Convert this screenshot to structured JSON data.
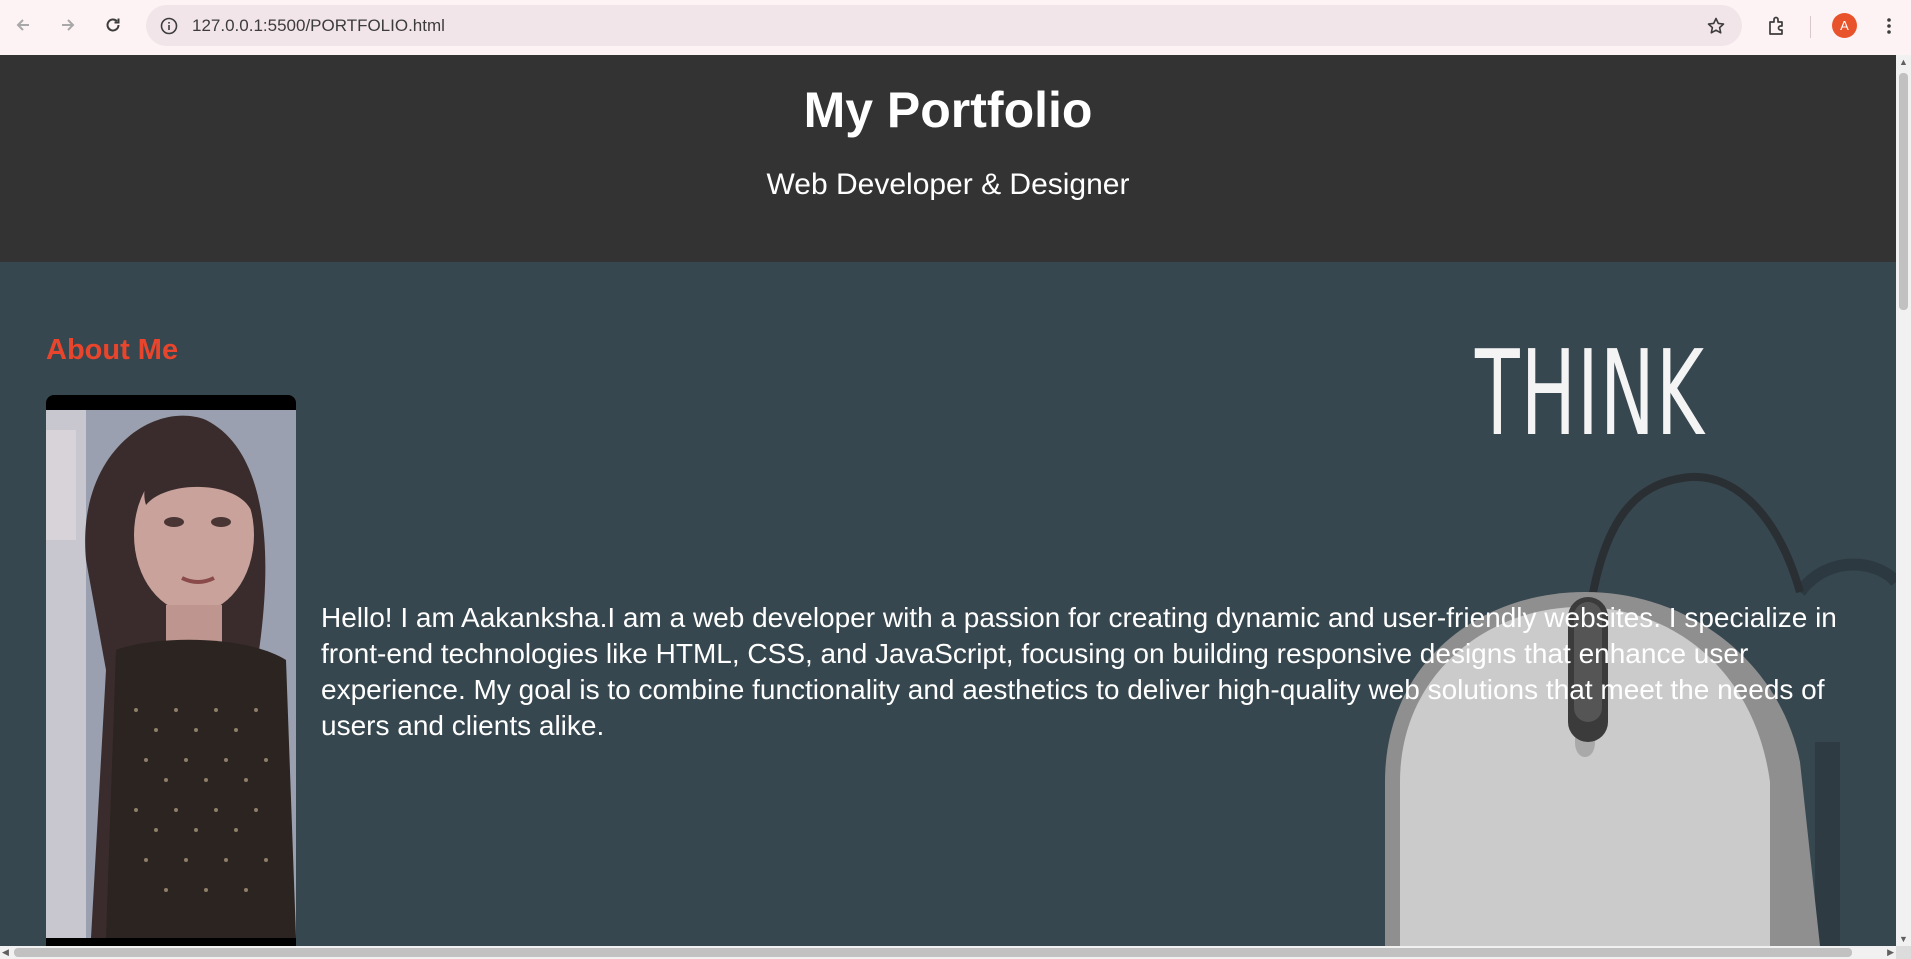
{
  "browser": {
    "url": "127.0.0.1:5500/PORTFOLIO.html",
    "profile_initial": "A",
    "icons": [
      "back-arrow-icon",
      "forward-arrow-icon",
      "reload-icon",
      "site-info-icon",
      "bookmark-star-icon",
      "extensions-icon",
      "kebab-menu-icon"
    ]
  },
  "header": {
    "title": "My Portfolio",
    "subtitle": "Web Developer & Designer"
  },
  "about": {
    "heading": "About Me",
    "bio": "Hello! I am Aakanksha.I am a web developer with a passion for creating dynamic and user-friendly websites. I specialize in front-end technologies like HTML, CSS, and JavaScript, focusing on building responsive designs that enhance user experience. My goal is to combine functionality and aesthetics to deliver high-quality web solutions that meet the needs of users and clients alike.",
    "background_art_text": "THINK"
  },
  "colors": {
    "header_bg": "#333333",
    "section_bg": "#37474f",
    "heading_accent": "#e8452c",
    "chrome_bg": "#fdf3f4",
    "profile_badge": "#e8532b"
  }
}
